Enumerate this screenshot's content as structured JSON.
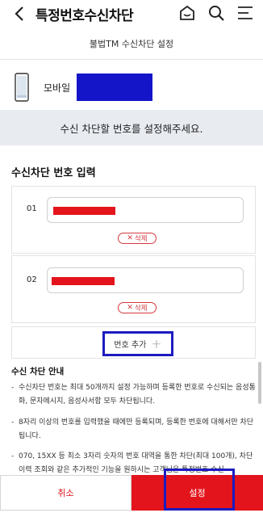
{
  "header": {
    "title": "특정번호수신차단",
    "icons": [
      "back-arrow",
      "home",
      "search",
      "menu"
    ]
  },
  "subheader": {
    "label": "불법TM 수신차단 설정"
  },
  "device": {
    "label": "모바일"
  },
  "notice": {
    "text": "수신 차단할 번호를 설정해주세요."
  },
  "section": {
    "title": "수신차단 번호 입력"
  },
  "entries": [
    {
      "index": "01",
      "delete_label": "삭제"
    },
    {
      "index": "02",
      "delete_label": "삭제"
    }
  ],
  "add": {
    "label": "번호 추가"
  },
  "guide": {
    "title": "수신 차단 안내",
    "items": [
      "수신차단 번호는 최대 50개까지 설정 가능하며 등록한 번호로 수신되는 음성통화, 문자메시지, 음성사서함 모두 차단됩니다.",
      "8자리 이상의 번호를 입력했을 때에만 등록되며, 등록한 번호에 대해서만 차단 됩니다.",
      "070, 15XX 등 최소 3자리 숫자의 번호 대역을 통한 차단(최대 100개), 차단 이력 조회와 같은 추가적인 기능을 원하시는 고객님은 특정번호 수신"
    ]
  },
  "footer": {
    "cancel_label": "취소",
    "confirm_label": "설정"
  },
  "colors": {
    "accent": "#e3141c",
    "highlight": "#1c1cc0",
    "notice_bg": "#e8ebf0"
  }
}
